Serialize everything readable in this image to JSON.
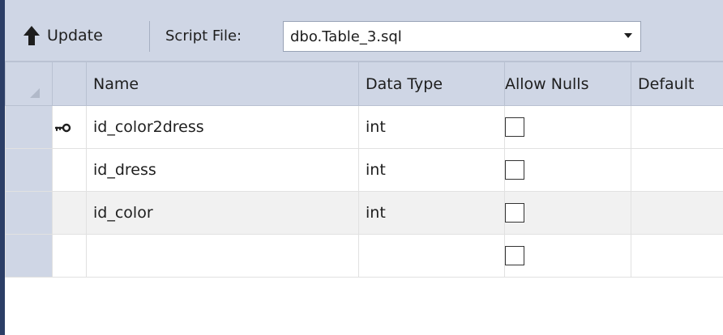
{
  "toolbar": {
    "update_label": "Update",
    "script_file_label": "Script File:",
    "script_file_value": "dbo.Table_3.sql"
  },
  "grid": {
    "columns": {
      "name": "Name",
      "data_type": "Data Type",
      "allow_nulls": "Allow Nulls",
      "default": "Default"
    },
    "rows": [
      {
        "name": "id_color2dress",
        "data_type": "int",
        "allow_nulls": false,
        "default": "",
        "primary_key": true
      },
      {
        "name": "id_dress",
        "data_type": "int",
        "allow_nulls": false,
        "default": "",
        "primary_key": false
      },
      {
        "name": "id_color",
        "data_type": "int",
        "allow_nulls": false,
        "default": "",
        "primary_key": false
      },
      {
        "name": "",
        "data_type": "",
        "allow_nulls": false,
        "default": "",
        "primary_key": false
      }
    ]
  },
  "colors": {
    "toolbar_bg": "#cfd6e5",
    "window_edge": "#2c3e66",
    "selected_row_bg": "#f1f1f1"
  },
  "icons": {
    "update": "up-arrow-icon",
    "dropdown": "chevron-down-icon",
    "primary_key": "key-icon"
  }
}
